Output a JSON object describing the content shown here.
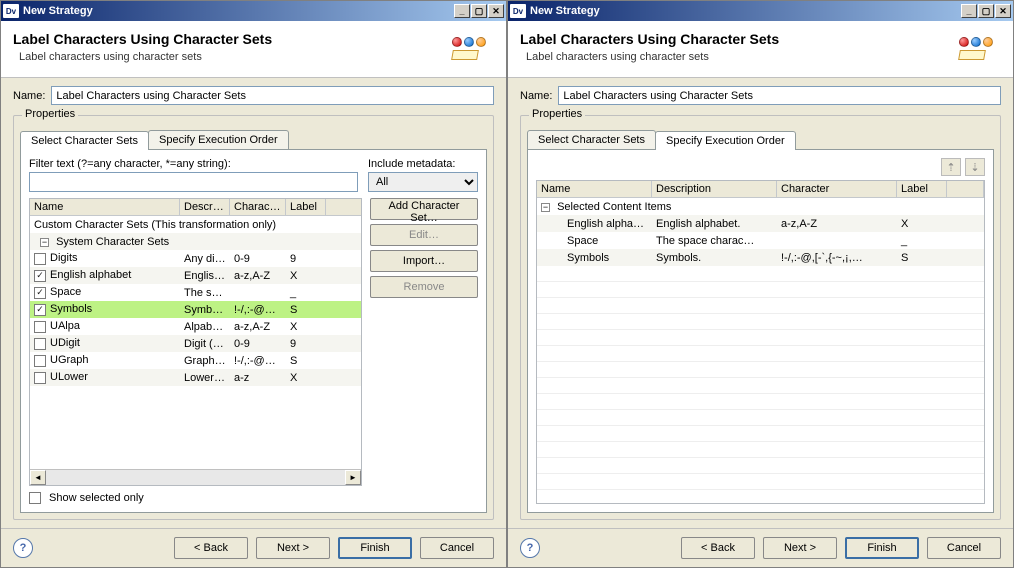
{
  "titlebar": {
    "icon_text": "Dv",
    "title": "New Strategy",
    "min_char": "_",
    "max_char": "▢",
    "close_char": "✕"
  },
  "header": {
    "title": "Label Characters Using Character Sets",
    "subtitle": "Label characters using character sets"
  },
  "name_field": {
    "label": "Name:",
    "value": "Label Characters using Character Sets"
  },
  "properties_legend": "Properties",
  "tabs": {
    "select": "Select Character Sets",
    "order": "Specify Execution Order"
  },
  "left": {
    "filter_label": "Filter text (?=any character, *=any string):",
    "filter_value": "",
    "metadata_label": "Include metadata:",
    "metadata_value": "All",
    "columns": {
      "name": "Name",
      "desc": "Descri…",
      "char": "Charac…",
      "label": "Label"
    },
    "tree": {
      "custom": "Custom Character Sets (This transformation only)",
      "system": "System Character Sets",
      "rows": [
        {
          "checked": false,
          "name": "Digits",
          "desc": "Any di…",
          "char": "0-9",
          "label": "9"
        },
        {
          "checked": true,
          "name": "English alphabet",
          "desc": "English…",
          "char": "a-z,A-Z",
          "label": "X"
        },
        {
          "checked": true,
          "name": "Space",
          "desc": "The sp…",
          "char": "",
          "label": "_"
        },
        {
          "checked": true,
          "name": "Symbols",
          "desc": "Symbols.",
          "char": "!-/,:-@…",
          "label": "S",
          "selected": true
        },
        {
          "checked": false,
          "name": "UAlpa",
          "desc": "Alpabe…",
          "char": "a-z,A-Z",
          "label": "X"
        },
        {
          "checked": false,
          "name": "UDigit",
          "desc": "Digit (…",
          "char": "0-9",
          "label": "9"
        },
        {
          "checked": false,
          "name": "UGraph",
          "desc": "Graph…",
          "char": "!-/,:-@…",
          "label": "S"
        },
        {
          "checked": false,
          "name": "ULower",
          "desc": "Lower…",
          "char": "a-z",
          "label": "X"
        }
      ]
    },
    "buttons": {
      "add": "Add Character Set…",
      "edit": "Edit…",
      "import": "Import…",
      "remove": "Remove"
    },
    "show_selected_label": "Show selected only"
  },
  "right": {
    "columns": {
      "name": "Name",
      "desc": "Description",
      "char": "Character",
      "label": "Label"
    },
    "group": "Selected Content Items",
    "rows": [
      {
        "name": "English alpha…",
        "desc": "English alphabet.",
        "char": "a-z,A-Z",
        "label": "X"
      },
      {
        "name": "Space",
        "desc": "The space charac…",
        "char": "",
        "label": "_"
      },
      {
        "name": "Symbols",
        "desc": "Symbols.",
        "char": "!-/,:-@,[-`,{-~,¡,…",
        "label": "S"
      }
    ]
  },
  "footer": {
    "back": "< Back",
    "next": "Next >",
    "finish": "Finish",
    "cancel": "Cancel"
  }
}
